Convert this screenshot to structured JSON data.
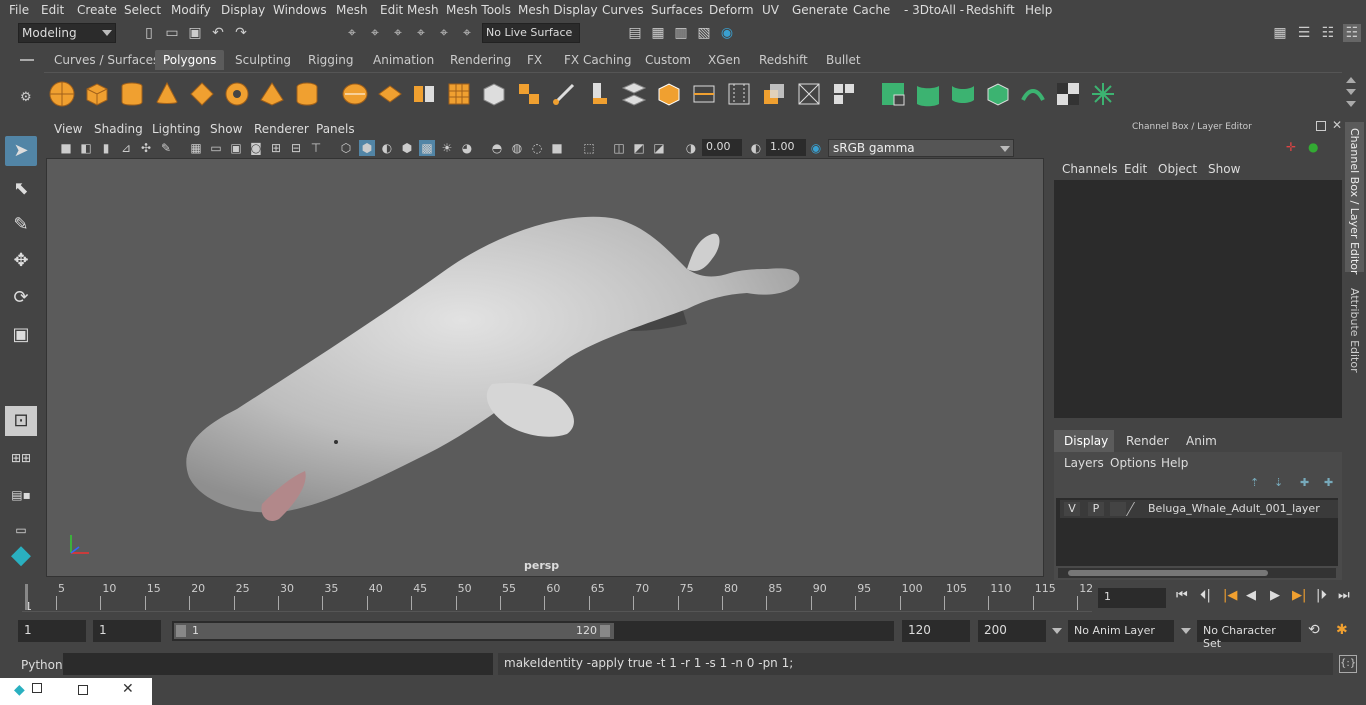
{
  "menubar": {
    "items": [
      "File",
      "Edit",
      "Create",
      "Select",
      "Modify",
      "Display",
      "Windows",
      "Mesh",
      "Edit Mesh",
      "Mesh Tools",
      "Mesh Display",
      "Curves",
      "Surfaces",
      "Deform",
      "UV",
      "Generate",
      "Cache",
      "- 3DtoAll -",
      "Redshift",
      "Help"
    ]
  },
  "statusline": {
    "mode": "Modeling",
    "live_surface": "No Live Surface"
  },
  "shelf": {
    "tabs": [
      "Curves / Surfaces",
      "Polygons",
      "Sculpting",
      "Rigging",
      "Animation",
      "Rendering",
      "FX",
      "FX Caching",
      "Custom",
      "XGen",
      "Redshift",
      "Bullet"
    ],
    "active_tab": "Polygons"
  },
  "viewport": {
    "menu": [
      "View",
      "Shading",
      "Lighting",
      "Show",
      "Renderer",
      "Panels"
    ],
    "exposure": "0.00",
    "gamma_value": "1.00",
    "color_space": "sRGB gamma",
    "camera": "persp"
  },
  "channel_box": {
    "title": "Channel Box / Layer Editor",
    "menu": [
      "Channels",
      "Edit",
      "Object",
      "Show"
    ]
  },
  "layer_editor": {
    "tabs": [
      "Display",
      "Render",
      "Anim"
    ],
    "active_tab": "Display",
    "menu": [
      "Layers",
      "Options",
      "Help"
    ],
    "layer": {
      "v": "V",
      "p": "P",
      "name": "Beluga_Whale_Adult_001_layer"
    }
  },
  "side_tabs": {
    "channel": "Channel Box / Layer Editor",
    "attribute": "Attribute Editor"
  },
  "timeline": {
    "ticks": [
      "5",
      "10",
      "15",
      "20",
      "25",
      "30",
      "35",
      "40",
      "45",
      "50",
      "55",
      "60",
      "65",
      "70",
      "75",
      "80",
      "85",
      "90",
      "95",
      "100",
      "105",
      "110",
      "115",
      "12"
    ],
    "start_label": "1",
    "current_frame": "1"
  },
  "range": {
    "start": "1",
    "start2": "1",
    "slider_start": "1",
    "slider_end": "120",
    "end": "120",
    "end2": "200",
    "anim_layer": "No Anim Layer",
    "character_set": "No Character Set"
  },
  "cmdline": {
    "language": "Python",
    "output": "makeIdentity -apply true -t 1 -r 1 -s 1 -n 0 -pn 1;"
  },
  "colors": {
    "accent": "#5285a6",
    "shelf_green": "#3cb371",
    "shelf_orange": "#f0a030"
  }
}
